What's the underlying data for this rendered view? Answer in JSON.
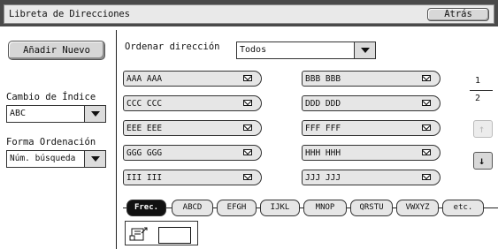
{
  "header": {
    "title": "Libreta de Direcciones",
    "back_label": "Atrás"
  },
  "left": {
    "add_new_label": "Añadir Nuevo",
    "index_change_label": "Cambio de Índice",
    "index_value": "ABC",
    "sort_form_label": "Forma Ordenación",
    "sort_form_value": "Núm. búsqueda"
  },
  "sort": {
    "label": "Ordenar dirección",
    "value": "Todos"
  },
  "entries": [
    "AAA AAA",
    "BBB BBB",
    "CCC CCC",
    "DDD DDD",
    "EEE EEE",
    "FFF FFF",
    "GGG GGG",
    "HHH HHH",
    "III III",
    "JJJ JJJ"
  ],
  "pager": {
    "current": "1",
    "total": "2"
  },
  "tabs": [
    "Frec.",
    "ABCD",
    "EFGH",
    "IJKL",
    "MNOP",
    "QRSTU",
    "VWXYZ",
    "etc."
  ],
  "icons": {
    "envelope": "envelope-icon",
    "up": "arrow-up-icon",
    "down": "arrow-down-icon",
    "phone": "phone-book-icon"
  }
}
